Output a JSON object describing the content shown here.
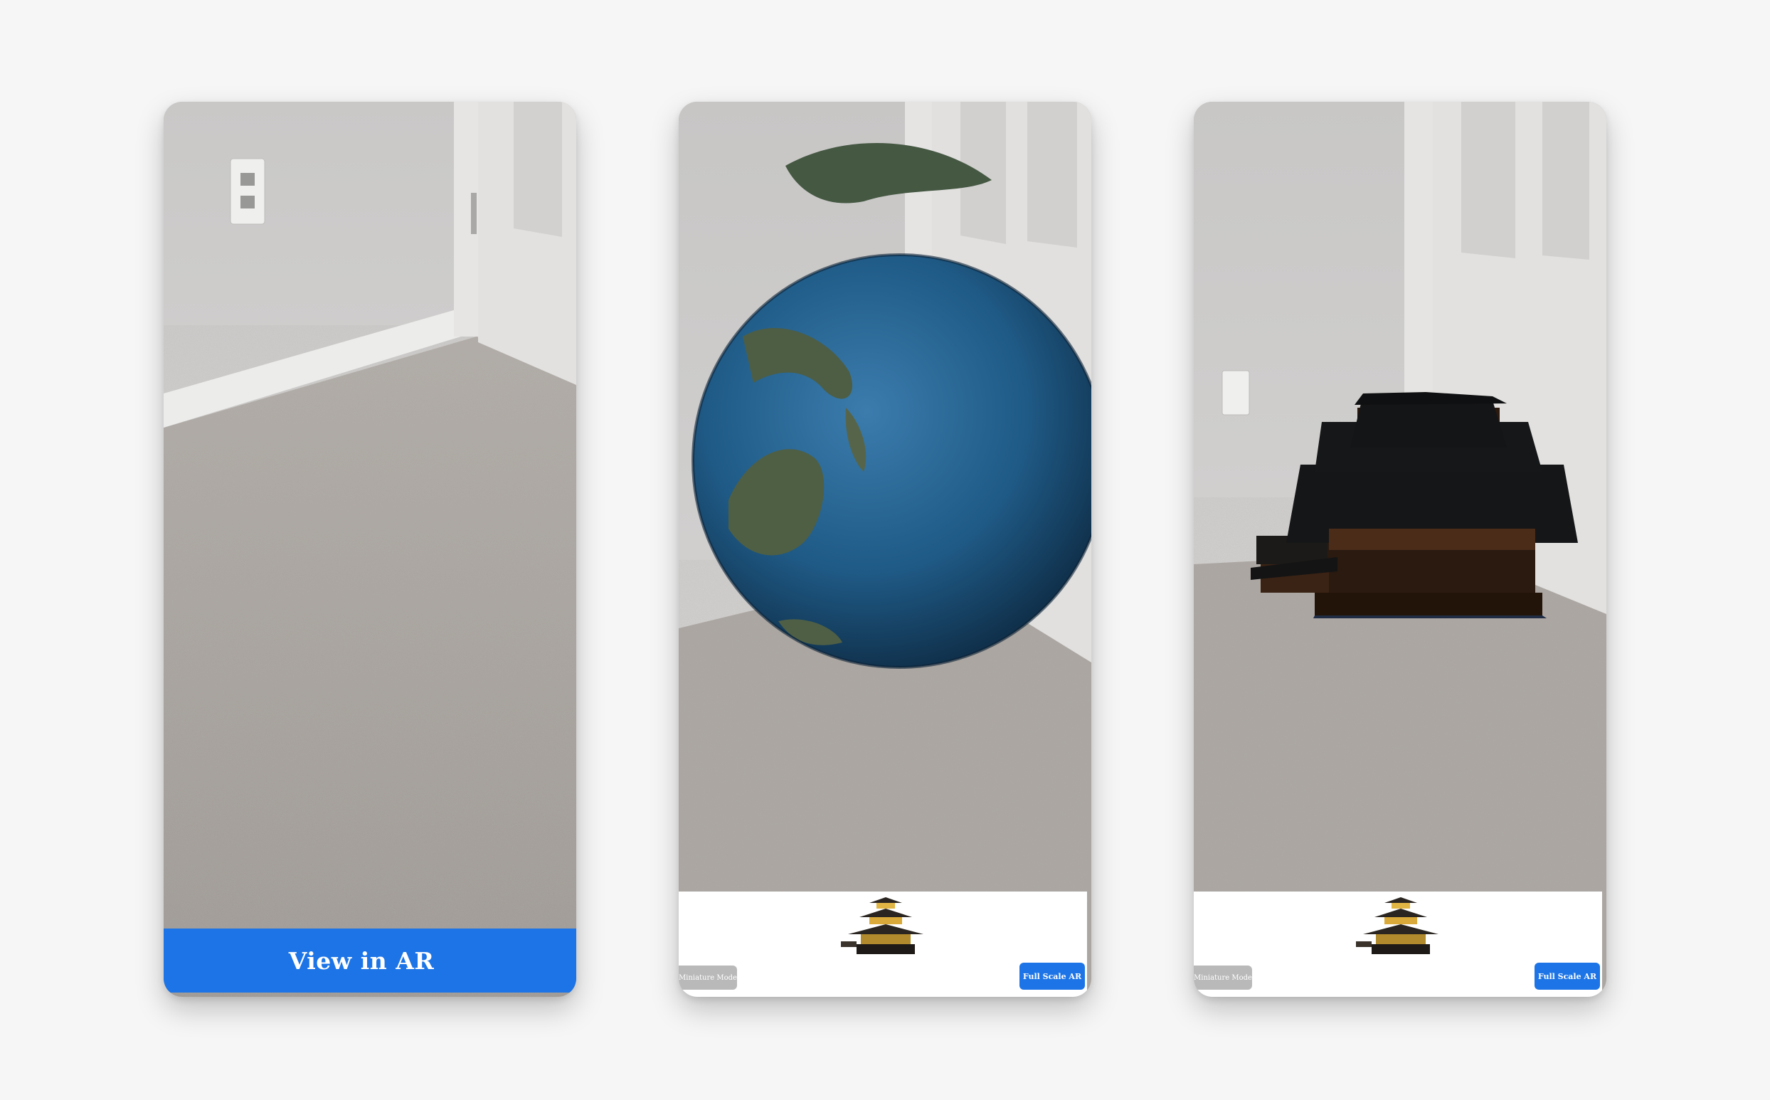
{
  "colors": {
    "background": "#f6f6f6",
    "accent": "#1c74e6",
    "secondary_button": "#b9b9b9",
    "wall": "#d4d3d2",
    "carpet": "#aaa6a2"
  },
  "screens": [
    {
      "ar_button": {
        "label": "View in AR",
        "icon": "none"
      }
    },
    {
      "model": "globe-earth",
      "thumbnail_icon": "temple-icon",
      "miniature_button": {
        "label": "Miniature Model"
      },
      "full_scale_button": {
        "label": "Full Scale AR"
      }
    },
    {
      "model": "japanese-temple",
      "thumbnail_icon": "temple-icon",
      "miniature_button": {
        "label": "Miniature Model"
      },
      "full_scale_button": {
        "label": "Full Scale AR"
      }
    }
  ]
}
